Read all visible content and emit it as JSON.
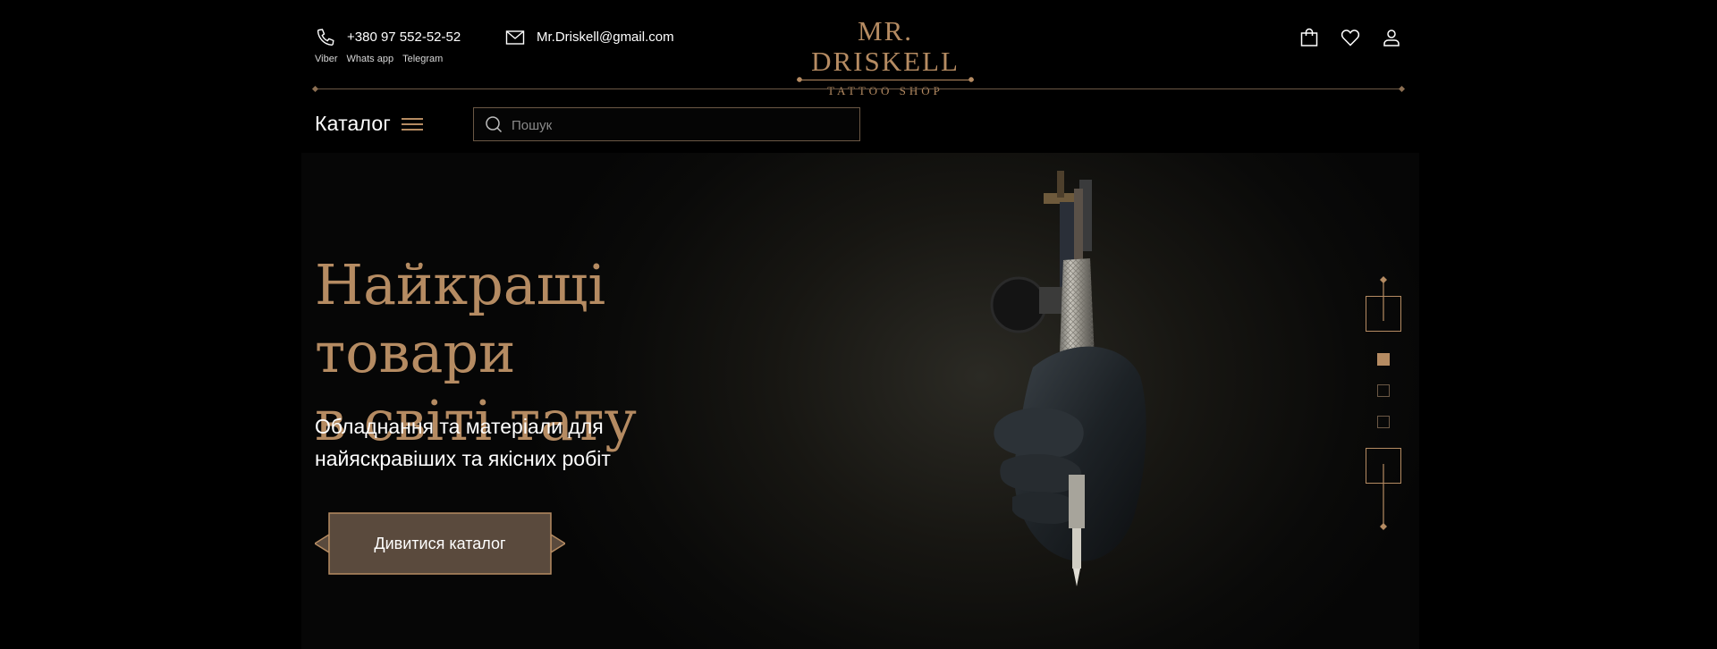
{
  "header": {
    "phone": "+380 97 552-52-52",
    "messengers": [
      "Viber",
      "Whats app",
      "Telegram"
    ],
    "email": "Mr.Driskell@gmail.com",
    "logo_title": "MR. DRISKELL",
    "logo_subtitle": "TATTOO SHOP"
  },
  "nav": {
    "catalog_label": "Каталог",
    "search_placeholder": "Пошук"
  },
  "hero": {
    "title_line1": "Найкращі товари",
    "title_line2": "в світі тату",
    "subtitle_line1": "Обладнання та матеріали для",
    "subtitle_line2": "найяскравіших та якісних робіт",
    "cta_label": "Дивитися каталог",
    "active_slide": 1,
    "slide_count": 3
  },
  "colors": {
    "accent": "#b58b62",
    "background": "#000000",
    "button_fill": "#5a4a3d",
    "divider": "#6b5845"
  },
  "icons": [
    "phone-icon",
    "mail-icon",
    "bag-icon",
    "heart-icon",
    "user-icon",
    "menu-icon",
    "search-icon"
  ]
}
